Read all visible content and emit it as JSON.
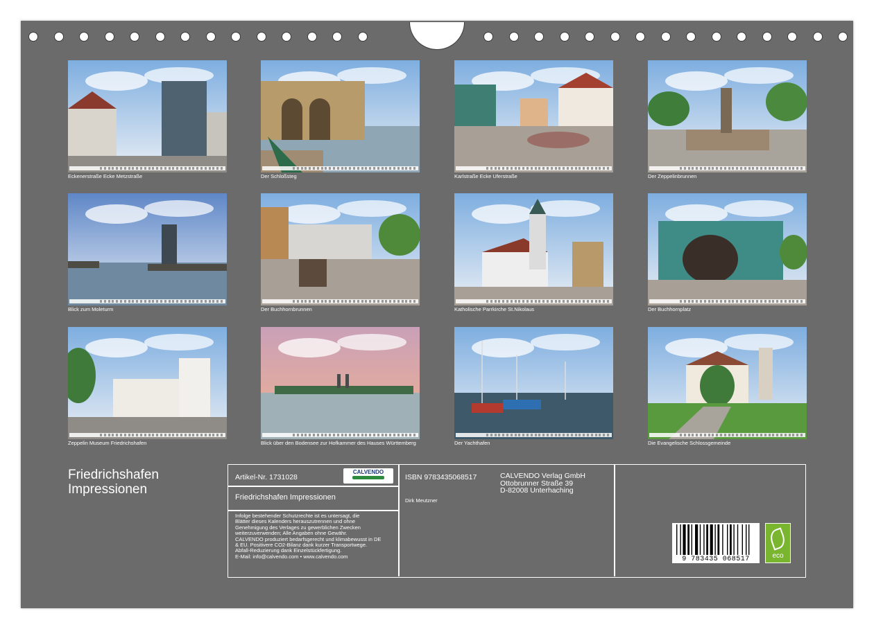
{
  "photos": [
    {
      "caption": "Eckenerstraße Ecke Metzstraße",
      "scene": "street-buildings"
    },
    {
      "caption": "Der Schloßsteg",
      "scene": "pier-arcade"
    },
    {
      "caption": "Karlstraße Ecke Uferstraße",
      "scene": "plaza-houses"
    },
    {
      "caption": "Der Zeppelinbrunnen",
      "scene": "fountain"
    },
    {
      "caption": "Blick zum Moleturm",
      "scene": "lake-tower"
    },
    {
      "caption": "Der Buchhornbrunnen",
      "scene": "sculpture-square"
    },
    {
      "caption": "Katholische Parrkirche St.Nikolaus",
      "scene": "church"
    },
    {
      "caption": "Der Buchhornplatz",
      "scene": "glass-building"
    },
    {
      "caption": "Zeppelin Museum Friedrichshafen",
      "scene": "museum"
    },
    {
      "caption": "Blick über den Bodensee zur Hofkammer des Hauses Württemberg",
      "scene": "sunset-lake"
    },
    {
      "caption": "Der Yachthafen",
      "scene": "harbor"
    },
    {
      "caption": "Die Evangelische Schlossgemeinde",
      "scene": "castle-church"
    }
  ],
  "calendar_title": {
    "line1": "Friedrichshafen",
    "line2": "Impressionen"
  },
  "imprint": {
    "article_no": "Artikel-Nr. 1731028",
    "logo_text": "CALVENDO",
    "product_title": "Friedrichshafen Impressionen",
    "legal": [
      "Infolge bestehender Schutzrechte ist es untersagt, die",
      "Blätter dieses Kalenders herauszutrennen und ohne",
      "Genehmigung des Verlages zu gewerblichen Zwecken",
      "weiterzuverwenden; Alle Angaben ohne Gewähr.",
      "CALVENDO produziert bedarfsgerecht und klimabewusst in DE",
      "& EU. Positivere CO2-Bilanz dank kurzer Transportwege.",
      "Abfall-Reduzierung dank Einzelstückfertigung.",
      "E-Mail: info@calvendo.com • www.calvendo.com"
    ],
    "isbn": "ISBN 9783435068517",
    "author": "Dirk Meutzner",
    "publisher": [
      "CALVENDO Verlag GmbH",
      "Ottobrunner Straße 39",
      "D-82008 Unterhaching"
    ],
    "barcode_number": "9 783435 068517",
    "eco_label": "eco"
  },
  "colors": {
    "board": "#6b6b6b",
    "text": "#ffffff",
    "eco_green": "#7ab52f"
  }
}
